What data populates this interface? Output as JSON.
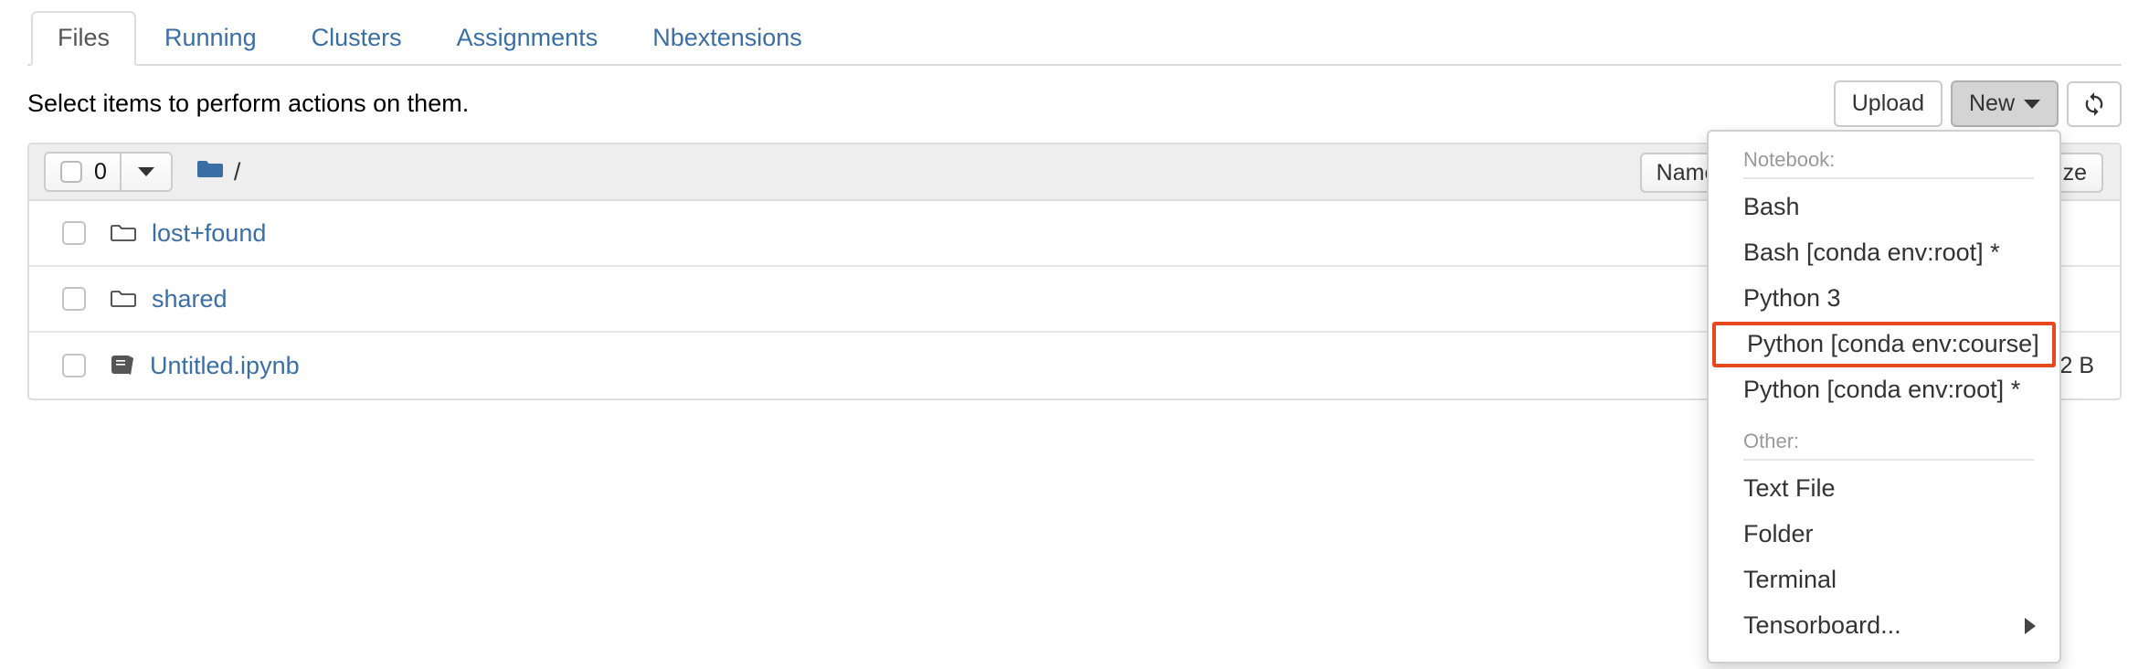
{
  "tabs": [
    {
      "label": "Files",
      "active": true
    },
    {
      "label": "Running",
      "active": false
    },
    {
      "label": "Clusters",
      "active": false
    },
    {
      "label": "Assignments",
      "active": false
    },
    {
      "label": "Nbextensions",
      "active": false
    }
  ],
  "actionbar": {
    "select_note": "Select items to perform actions on them.",
    "upload_label": "Upload",
    "new_label": "New",
    "refresh_icon": "refresh-icon"
  },
  "filelist": {
    "selected_count": "0",
    "breadcrumb_root": "/",
    "folder_icon": "folder-icon",
    "sort_name_label": "Name",
    "sort_size_label": "Size",
    "rows": [
      {
        "name": "lost+found",
        "icon": "folder-outline-icon",
        "size": ""
      },
      {
        "name": "shared",
        "icon": "folder-outline-icon",
        "size": ""
      },
      {
        "name": "Untitled.ipynb",
        "icon": "notebook-icon",
        "size": "2 B"
      }
    ]
  },
  "new_menu": {
    "notebook_label": "Notebook:",
    "other_label": "Other:",
    "notebook_items": [
      {
        "label": "Bash",
        "highlighted": false
      },
      {
        "label": "Bash [conda env:root] *",
        "highlighted": false
      },
      {
        "label": "Python 3",
        "highlighted": false
      },
      {
        "label": "Python [conda env:course]",
        "highlighted": true
      },
      {
        "label": "Python [conda env:root] *",
        "highlighted": false
      }
    ],
    "other_items": [
      {
        "label": "Text File",
        "submenu": false
      },
      {
        "label": "Folder",
        "submenu": false
      },
      {
        "label": "Terminal",
        "submenu": false
      },
      {
        "label": "Tensorboard...",
        "submenu": true
      }
    ]
  },
  "colors": {
    "link_blue": "#3b6ea5",
    "highlight_orange": "#e8481f",
    "header_gray": "#eeeeee"
  }
}
